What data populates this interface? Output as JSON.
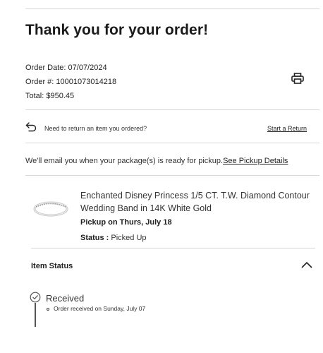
{
  "page": {
    "title": "Thank you for your order!"
  },
  "order": {
    "date_label": "Order Date:",
    "date_value": "07/07/2024",
    "number_label": "Order #:",
    "number_value": "10001073014218",
    "total_label": "Total:",
    "total_value": "$950.45"
  },
  "return": {
    "text": "Need to return an item you ordered?",
    "link": "Start a Return"
  },
  "pickup_notice": {
    "text": "We'll email you when your package(s) is ready for pickup.",
    "link": "See Pickup Details"
  },
  "product": {
    "name": "Enchanted Disney Princess 1/5 CT. T.W. Diamond Contour Wedding Band in 14K White Gold",
    "pickup": "Pickup on Thurs, July 18",
    "status_label": "Status :",
    "status_value": "Picked Up"
  },
  "item_status": {
    "heading": "Item Status",
    "steps": [
      {
        "label": "Received",
        "detail": "Order received on Sunday, July 07"
      }
    ]
  },
  "icons": {
    "print": "printer-icon",
    "return": "return-arrow-icon",
    "collapse": "chevron-up-icon",
    "step": "check-circle-icon"
  }
}
